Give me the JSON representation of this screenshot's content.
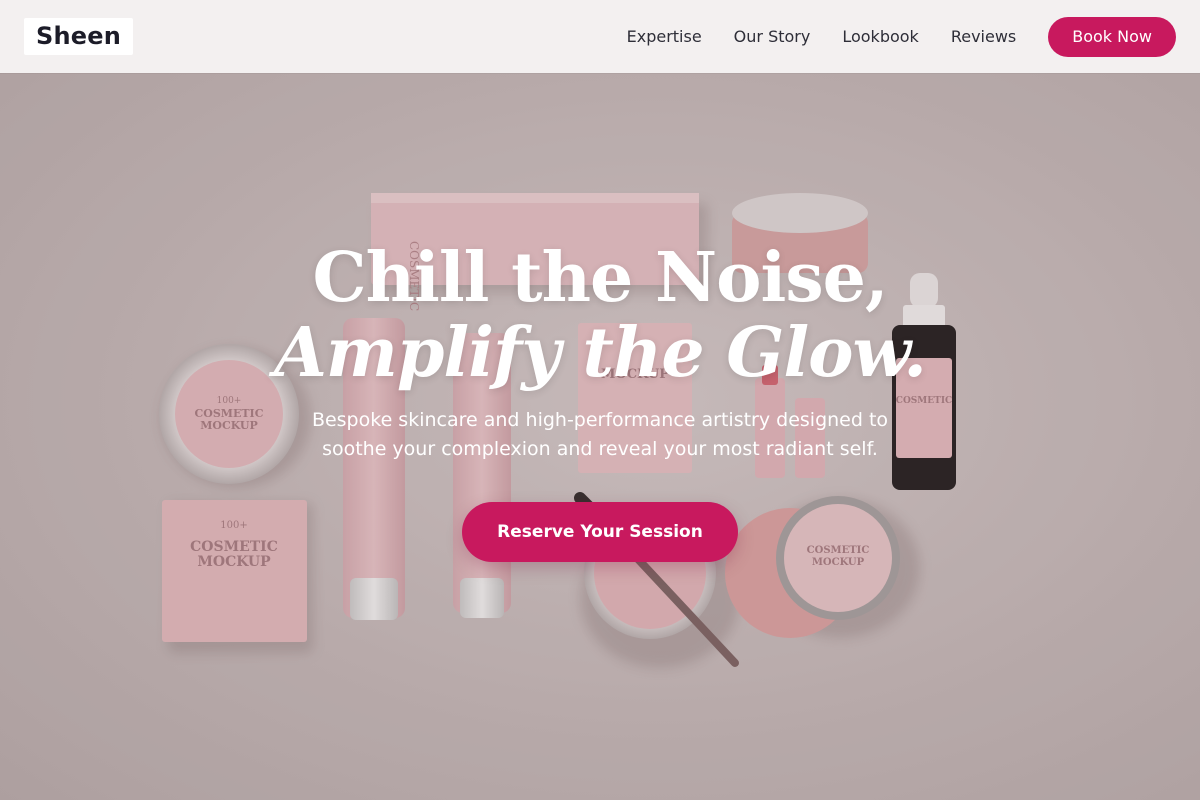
{
  "header": {
    "logo": "Sheen",
    "nav": [
      "Expertise",
      "Our Story",
      "Lookbook",
      "Reviews"
    ],
    "cta_label": "Book Now"
  },
  "hero": {
    "headline_line1": "Chill the Noise,",
    "headline_line2": "Amplify the Glow.",
    "subtitle": "Bespoke skincare and high-performance artistry designed to soothe your complexion and reveal your most radiant self.",
    "cta_label": "Reserve Your Session",
    "image_subject": "pink cosmetic product mockups flat lay"
  },
  "colors": {
    "accent": "#c8195e",
    "header_bg": "#f3f0f0",
    "hero_bg": "#c6baba",
    "product_pink": "#e6b9be"
  }
}
